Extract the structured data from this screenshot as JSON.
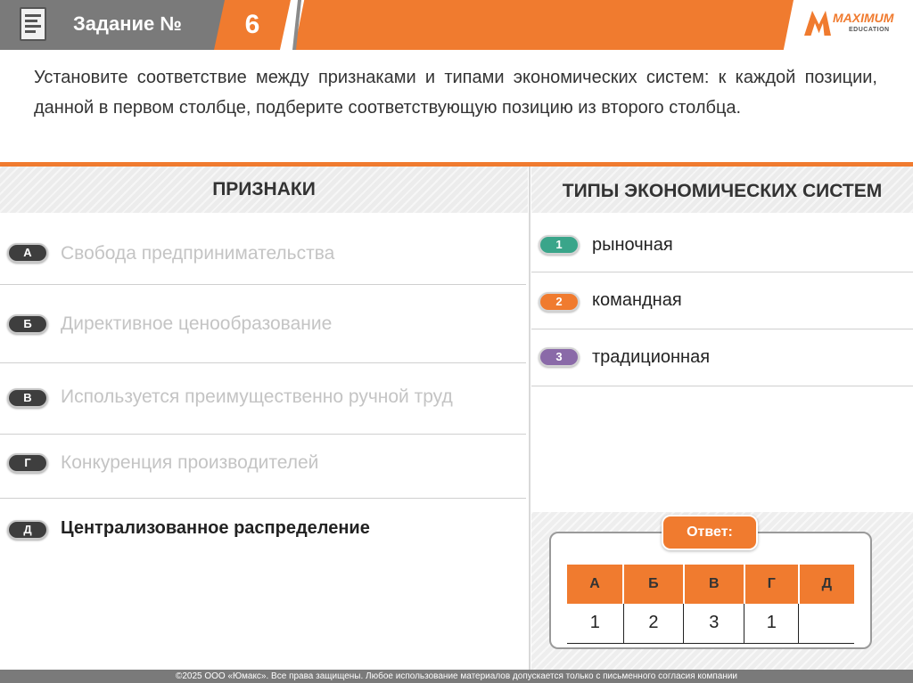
{
  "header": {
    "title": "Задание №",
    "task_number": "6",
    "logo_text": "MAXIMUM",
    "logo_sub": "EDUCATION",
    "icon": "document-icon"
  },
  "task": {
    "text": "Установите соответствие между признаками и типами экономических систем: к каждой позиции, данной в первом столбце, подберите соответствующую позицию из второго столбца."
  },
  "columns": {
    "left_title": "ПРИЗНАКИ",
    "right_title": "ТИПЫ ЭКОНОМИЧЕСКИХ СИСТЕМ"
  },
  "features": [
    {
      "letter": "А",
      "text": "Свобода предпринимательства"
    },
    {
      "letter": "Б",
      "text": "Директивное ценообразование"
    },
    {
      "letter": "В",
      "text": "Используется преимущественно ручной труд"
    },
    {
      "letter": "Г",
      "text": "Конкуренция производителей"
    },
    {
      "letter": "Д",
      "text": "Централизованное распределение"
    }
  ],
  "types": [
    {
      "num": "1",
      "text": "рыночная",
      "color": "#3aa58a"
    },
    {
      "num": "2",
      "text": "командная",
      "color": "#f07b2f"
    },
    {
      "num": "3",
      "text": "традиционная",
      "color": "#8a6aa8"
    }
  ],
  "answer": {
    "label": "Ответ:",
    "headers": [
      "А",
      "Б",
      "В",
      "Г",
      "Д"
    ],
    "values": [
      "1",
      "2",
      "3",
      "1",
      ""
    ]
  },
  "footer": {
    "text": "©2025 ООО «Юмакс». Все права защищены. Любое использование материалов допускается только с письменного согласия компании"
  },
  "colors": {
    "accent": "#f07b2f",
    "header_grey": "#7a7a7a"
  }
}
